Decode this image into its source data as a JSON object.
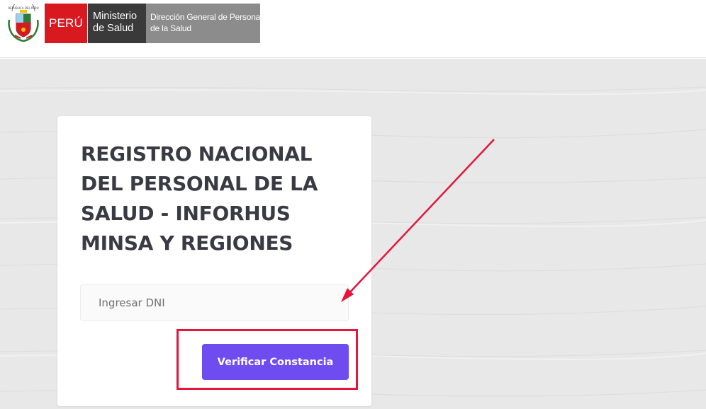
{
  "header": {
    "peru_label": "PERÚ",
    "ministerio_line1": "Ministerio",
    "ministerio_line2": "de Salud",
    "direccion_line1": "Dirección General de Personal",
    "direccion_line2": "de la Salud",
    "crest_text": "REPUBLICA DEL PERU"
  },
  "card": {
    "title_lines": [
      "REGISTRO NACIONAL",
      "DEL PERSONAL DE LA",
      "SALUD - INFORHUS",
      "MINSA Y REGIONES"
    ],
    "dni_placeholder": "Ingresar DNI",
    "dni_value": "",
    "verify_button_label": "Verificar Constancia"
  },
  "colors": {
    "brand_red": "#d91920",
    "button_purple": "#6e4cf0",
    "annotation_red": "#e5153c"
  }
}
